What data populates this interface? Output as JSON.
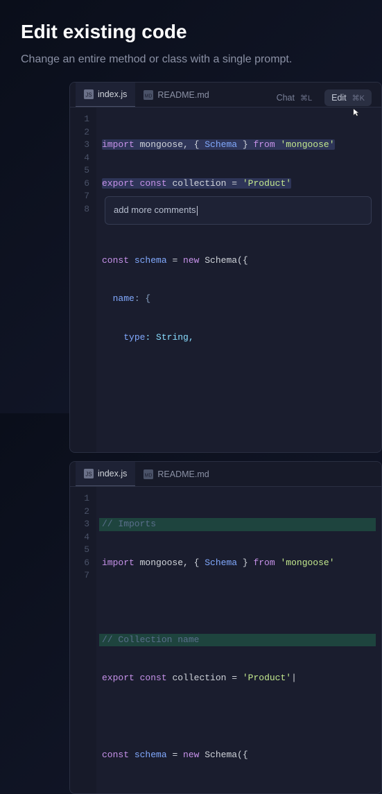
{
  "header": {
    "title": "Edit existing code",
    "subtitle": "Change an entire method or class with a single prompt."
  },
  "actions": {
    "chat_label": "Chat",
    "chat_shortcut": "⌘L",
    "edit_label": "Edit",
    "edit_shortcut": "⌘K"
  },
  "tabs": [
    {
      "name": "index.js",
      "icon": "js-file-icon"
    },
    {
      "name": "README.md",
      "icon": "md-file-icon"
    }
  ],
  "editor1": {
    "lines": {
      "1a": "import",
      "1b": " mongoose, { ",
      "1c": "Schema",
      "1d": " } ",
      "1e": "from",
      "1f": " ",
      "1g": "'mongoose'",
      "2a": "export",
      "2b": " ",
      "2c": "const",
      "2d": " collection = ",
      "2e": "'Product'",
      "3": "",
      "4a": "const",
      "4b": " ",
      "4c": "schema",
      "4d": " = ",
      "4e": "new",
      "4f": " Schema({",
      "5a": "  ",
      "5b": "name",
      "5c": ": {",
      "6a": "    ",
      "6b": "type",
      "6c": ": String,",
      "7": "",
      "8": ""
    },
    "gutter": {
      "1": "1",
      "2": "2",
      "3": "3",
      "4": "4",
      "5": "5",
      "6": "6",
      "7": "7",
      "8": "8"
    }
  },
  "prompt": {
    "text": "add more comments"
  },
  "editor2": {
    "lines": {
      "1a": "// Imports",
      "2a": "import",
      "2b": " mongoose, { ",
      "2c": "Schema",
      "2d": " } ",
      "2e": "from",
      "2f": " ",
      "2g": "'mongoose'",
      "3": "",
      "4a": "// Collection name",
      "5a": "export",
      "5b": " ",
      "5c": "const",
      "5d": " collection = ",
      "5e": "'Product'",
      "5f": "|",
      "6": "",
      "7a": "const",
      "7b": " ",
      "7c": "schema",
      "7d": " = ",
      "7e": "new",
      "7f": " Schema({"
    },
    "gutter": {
      "1": "1",
      "2": "2",
      "3": "3",
      "4": "4",
      "5": "5",
      "6": "6",
      "7": "7"
    }
  }
}
